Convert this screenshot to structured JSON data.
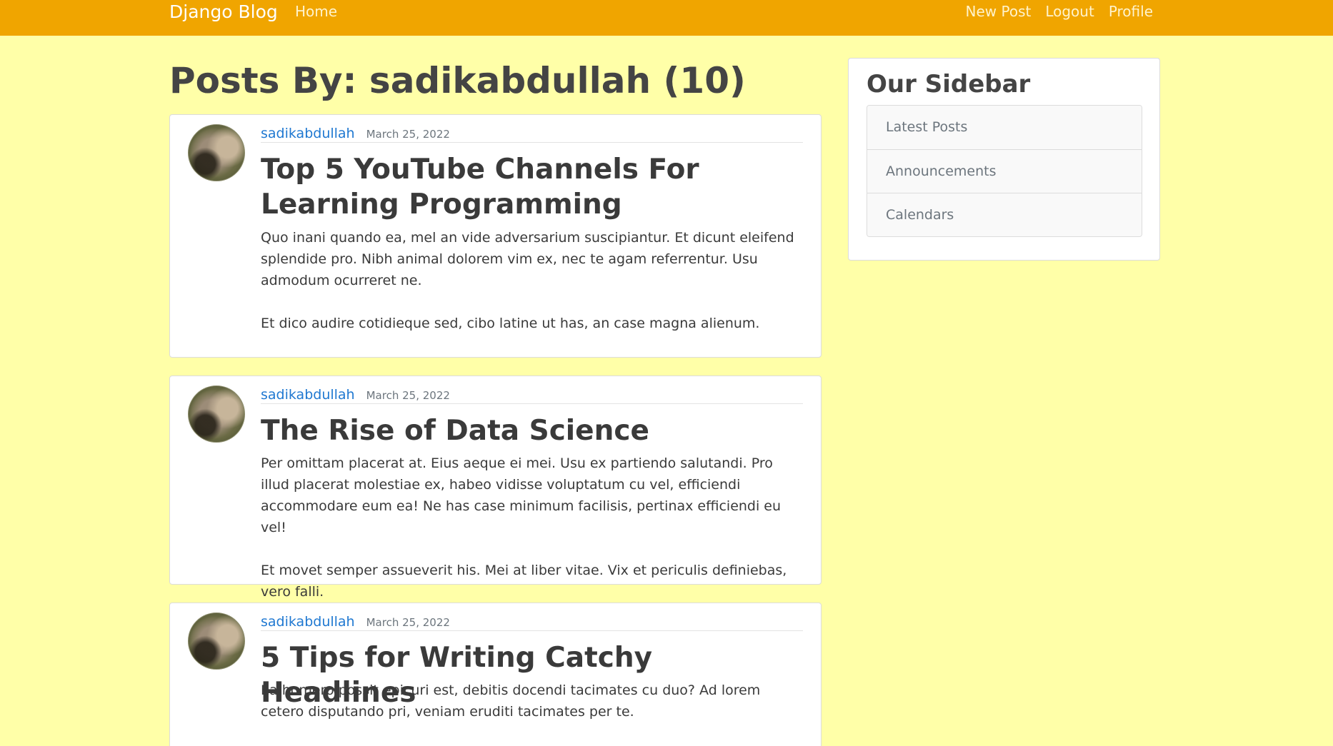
{
  "navbar": {
    "brand": "Django Blog",
    "home": "Home",
    "new_post": "New Post",
    "logout": "Logout",
    "profile": "Profile"
  },
  "page": {
    "title": "Posts By: sadikabdullah (10)"
  },
  "posts": [
    {
      "author": "sadikabdullah",
      "date": "March 25, 2022",
      "title": "Top 5 YouTube Channels For Learning Programming",
      "paragraphs": [
        "Quo inani quando ea, mel an vide adversarium suscipiantur. Et dicunt eleifend splendide pro. Nibh animal dolorem vim ex, nec te agam referrentur. Usu admodum ocurreret ne.",
        "Et dico audire cotidieque sed, cibo latine ut has, an case magna alienum."
      ]
    },
    {
      "author": "sadikabdullah",
      "date": "March 25, 2022",
      "title": "The Rise of Data Science",
      "paragraphs": [
        "Per omittam placerat at. Eius aeque ei mei. Usu ex partiendo salutandi. Pro illud placerat molestiae ex, habeo vidisse voluptatum cu vel, efficiendi accommodare eum ea! Ne has case minimum facilisis, pertinax efficiendi eu vel!",
        "Et movet semper assueverit his. Mei at liber vitae. Vix et periculis definiebas, vero falli."
      ]
    },
    {
      "author": "sadikabdullah",
      "date": "March 25, 2022",
      "title": "5 Tips for Writing Catchy Headlines",
      "paragraphs": [
        "Ea homero possit epicuri est, debitis docendi tacimates cu duo? Ad lorem cetero disputando pri, veniam eruditi tacimates per te."
      ]
    }
  ],
  "sidebar": {
    "title": "Our Sidebar",
    "items": [
      "Latest Posts",
      "Announcements",
      "Calendars"
    ]
  },
  "colors": {
    "navbar": "#f0a500",
    "background": "#ffffa8",
    "link": "#1f78d1"
  }
}
